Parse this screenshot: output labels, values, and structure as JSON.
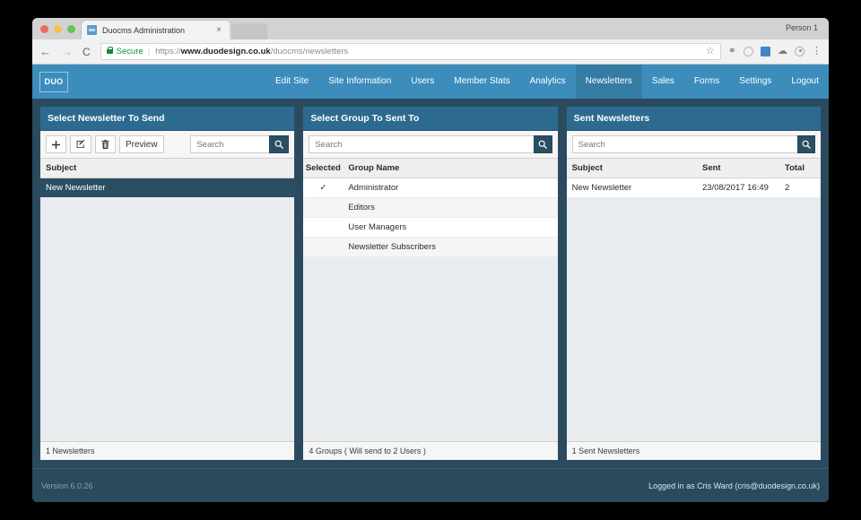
{
  "browser": {
    "tab_title": "Duocms Administration",
    "tab_close": "×",
    "profile": "Person 1",
    "back_icon": "←",
    "forward_icon": "→",
    "reload_icon": "⟳",
    "secure_label": "Secure",
    "url_scheme": "https://",
    "url_host": "www.duodesign.co.uk",
    "url_path": "/duocms/newsletters",
    "star_icon": "☆",
    "menu_icon": "⋮"
  },
  "topnav": {
    "brand": "DUO",
    "items": [
      {
        "label": "Edit Site",
        "active": false
      },
      {
        "label": "Site Information",
        "active": false
      },
      {
        "label": "Users",
        "active": false
      },
      {
        "label": "Member Stats",
        "active": false
      },
      {
        "label": "Analytics",
        "active": false
      },
      {
        "label": "Newsletters",
        "active": true
      },
      {
        "label": "Sales",
        "active": false
      },
      {
        "label": "Forms",
        "active": false
      },
      {
        "label": "Settings",
        "active": false
      },
      {
        "label": "Logout",
        "active": false
      }
    ]
  },
  "panel_left": {
    "title": "Select Newsletter To Send",
    "add_label": "+",
    "edit_label": "edit",
    "delete_label": "delete",
    "preview_label": "Preview",
    "search_placeholder": "Search",
    "search_value": "",
    "columns": {
      "subject": "Subject"
    },
    "rows": [
      {
        "subject": "New Newsletter",
        "selected": true
      }
    ],
    "footer": "1 Newsletters"
  },
  "panel_middle": {
    "title": "Select Group To Sent To",
    "search_placeholder": "Search",
    "search_value": "",
    "columns": {
      "selected": "Selected",
      "group_name": "Group Name"
    },
    "rows": [
      {
        "check": "✓",
        "group_name": "Administrator"
      },
      {
        "check": "",
        "group_name": "Editors"
      },
      {
        "check": "",
        "group_name": "User Managers"
      },
      {
        "check": "",
        "group_name": "Newsletter Subscribers"
      }
    ],
    "footer": "4 Groups ( Will send to 2 Users )"
  },
  "panel_right": {
    "title": "Sent Newsletters",
    "search_placeholder": "Search",
    "search_value": "",
    "columns": {
      "subject": "Subject",
      "sent": "Sent",
      "total": "Total"
    },
    "rows": [
      {
        "subject": "New Newsletter",
        "sent": "23/08/2017 16:49",
        "total": "2"
      }
    ],
    "footer": "1 Sent Newsletters"
  },
  "appfoot": {
    "version": "Version 6.0.26",
    "logged_in": "Logged in as Cris Ward (cris@duodesign.co.uk)"
  },
  "colors": {
    "brand_blue": "#3c8dbc",
    "nav_active": "#357ca5",
    "panel_header": "#2c6b8f",
    "dark_slate": "#2a4f63",
    "page_bg": "#2b4a5e",
    "panel_body": "#e8ecef"
  }
}
